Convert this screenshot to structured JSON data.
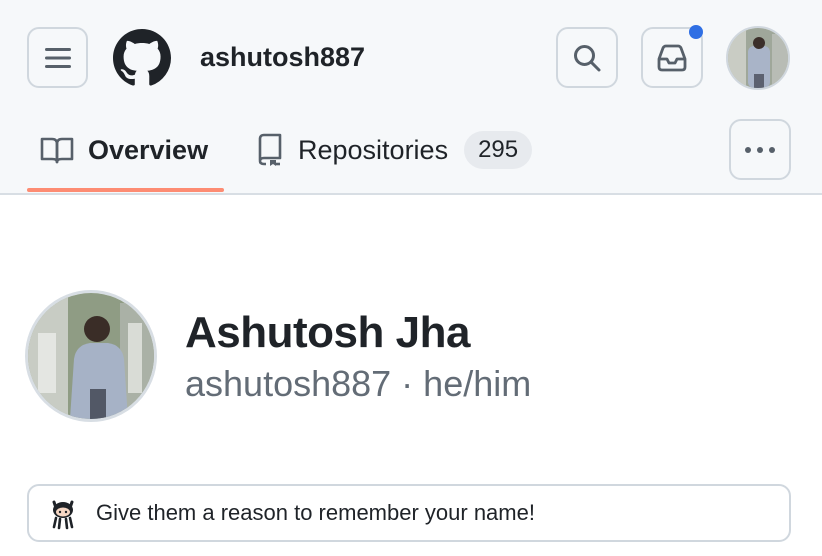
{
  "header": {
    "username": "ashutosh887",
    "notification_dot_color": "#2f6fe4",
    "icons": {
      "menu": "hamburger-icon",
      "logo": "github-mark-icon",
      "search": "search-icon",
      "inbox": "inbox-icon",
      "more": "kebab-horizontal-icon"
    }
  },
  "tabs": [
    {
      "label": "Overview",
      "icon": "book-icon",
      "selected": true
    },
    {
      "label": "Repositories",
      "icon": "repo-icon",
      "count": "295",
      "selected": false
    }
  ],
  "profile": {
    "full_name": "Ashutosh Jha",
    "login_and_pronouns": "ashutosh887 · he/him"
  },
  "status_prompt": {
    "text": "Give them a reason to remember your name!",
    "icon": "octocat-icon"
  },
  "colors": {
    "tab_underline": "#fd8c73",
    "header_bg": "#f6f8fa"
  }
}
